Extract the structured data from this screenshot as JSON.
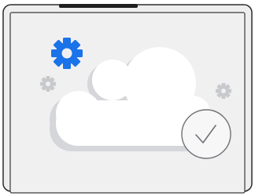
{
  "illustration": {
    "frame_icon": "tablet-frame",
    "cloud_icon": "cloud-icon",
    "check_icon": "checkmark-icon",
    "gear_icons": [
      "gear-icon-blue",
      "gear-icon-gray-left",
      "gear-icon-gray-right"
    ]
  },
  "colors": {
    "frame_background": "#eeeeef",
    "frame_border": "#2b2b2b",
    "top_bar": "#1f1f1f",
    "cloud_fill": "#ffffff",
    "cloud_shadow": "#d5d6d9",
    "accent_gear": "#1a73e8",
    "gray_gear": "#c7c9cc",
    "check_circle_fill": "#f7f7f8",
    "check_circle_stroke": "#6f7276"
  }
}
